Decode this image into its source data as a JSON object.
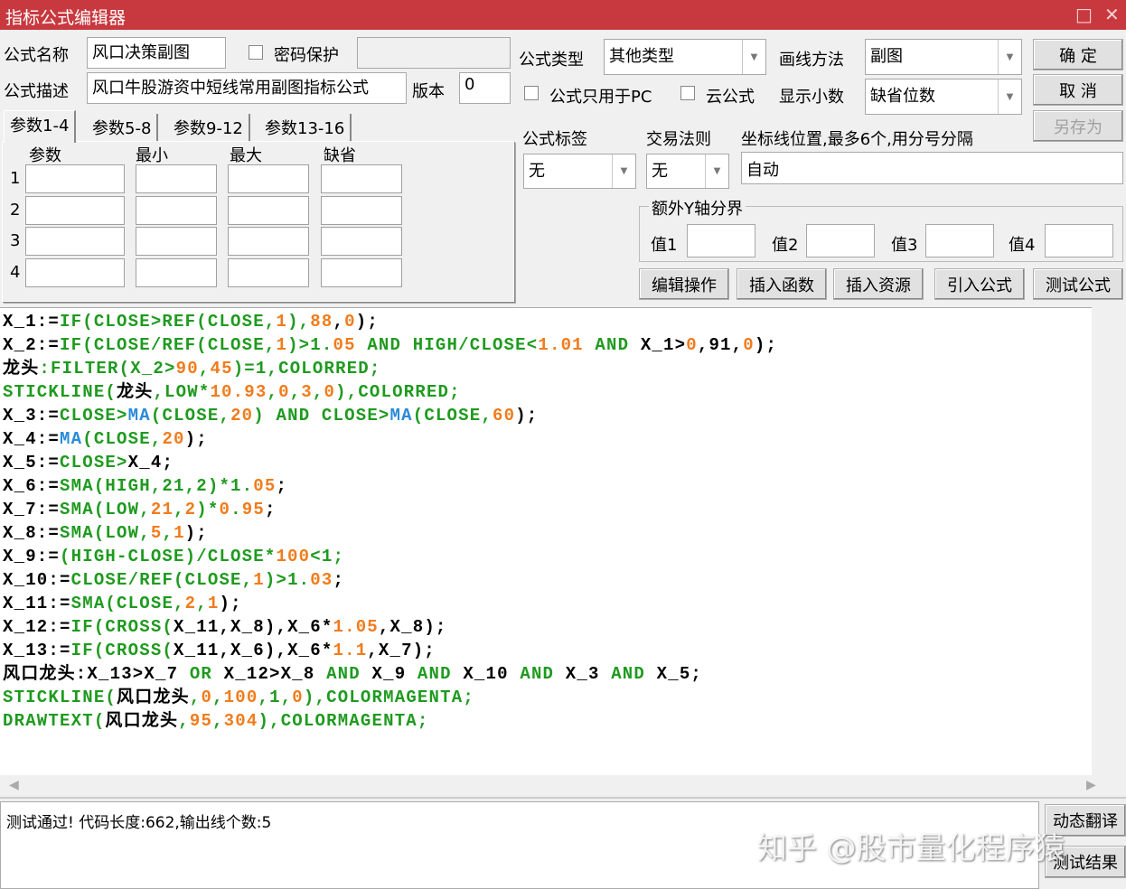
{
  "window": {
    "title": "指标公式编辑器",
    "maximize_icon": "□",
    "close_icon": "✕"
  },
  "form": {
    "name_label": "公式名称",
    "name_value": "风口决策副图",
    "password_label": "密码保护",
    "password_value": "",
    "desc_label": "公式描述",
    "desc_value": "风口牛股游资中短线常用副图指标公式",
    "version_label": "版本",
    "version_value": "0",
    "type_label": "公式类型",
    "type_value": "其他类型",
    "draw_label": "画线方法",
    "draw_value": "副图",
    "pc_only_label": "公式只用于PC",
    "cloud_label": "云公式",
    "decimal_label": "显示小数",
    "decimal_value": "缺省位数",
    "tag_label": "公式标签",
    "tag_value": "无",
    "rule_label": "交易法则",
    "rule_value": "无",
    "axis_label": "坐标线位置,最多6个,用分号分隔",
    "axis_value": "自动",
    "yaxis_group": "额外Y轴分界",
    "yvals": [
      "值1",
      "值2",
      "值3",
      "值4"
    ]
  },
  "buttons": {
    "ok": "确  定",
    "cancel": "取  消",
    "save_as": "另存为",
    "edit": "编辑操作",
    "insert_func": "插入函数",
    "insert_res": "插入资源",
    "import": "引入公式",
    "test": "测试公式",
    "dynamic": "动态翻译",
    "test_result": "测试结果"
  },
  "params": {
    "tabs": [
      "参数1-4",
      "参数5-8",
      "参数9-12",
      "参数13-16"
    ],
    "headers": [
      "参数",
      "最小",
      "最大",
      "缺省"
    ],
    "rows": [
      "1",
      "2",
      "3",
      "4"
    ]
  },
  "code_lines": [
    [
      [
        "X_1:=",
        "v"
      ],
      [
        "IF(CLOSE>REF(CLOSE,",
        "k"
      ],
      [
        "1",
        "n"
      ],
      [
        "),",
        "k"
      ],
      [
        "88",
        "n"
      ],
      [
        ",",
        "v"
      ],
      [
        "0",
        "n"
      ],
      [
        ");",
        "v"
      ]
    ],
    [
      [
        "X_2:=",
        "v"
      ],
      [
        "IF(CLOSE/REF(CLOSE,",
        "k"
      ],
      [
        "1",
        "n"
      ],
      [
        ")>",
        "k"
      ],
      [
        "1.",
        "k"
      ],
      [
        "05",
        "n"
      ],
      [
        " AND HIGH/CLOSE<",
        "k"
      ],
      [
        "1.",
        "n"
      ],
      [
        "01",
        "n"
      ],
      [
        " AND ",
        "k"
      ],
      [
        "X_1>",
        "v"
      ],
      [
        "0",
        "n"
      ],
      [
        ",91,",
        "v"
      ],
      [
        "0",
        "n"
      ],
      [
        ");",
        "v"
      ]
    ],
    [
      [
        "龙头",
        "v"
      ],
      [
        ":FILTER(X_2>",
        "k"
      ],
      [
        "90",
        "n"
      ],
      [
        ",",
        "k"
      ],
      [
        "45",
        "n"
      ],
      [
        ")=1,COLORRED;",
        "k"
      ]
    ],
    [
      [
        "STICKLINE(",
        "k"
      ],
      [
        "龙头",
        "v"
      ],
      [
        ",LOW*",
        "k"
      ],
      [
        "10.93",
        "n"
      ],
      [
        ",",
        "k"
      ],
      [
        "0",
        "n"
      ],
      [
        ",",
        "k"
      ],
      [
        "3",
        "n"
      ],
      [
        ",",
        "k"
      ],
      [
        "0",
        "n"
      ],
      [
        "),COLORRED;",
        "k"
      ]
    ],
    [
      [
        "X_3:=",
        "v"
      ],
      [
        "CLOSE>",
        "k"
      ],
      [
        "MA",
        "b"
      ],
      [
        "(CLOSE,",
        "k"
      ],
      [
        "20",
        "n"
      ],
      [
        ") AND CLOSE>",
        "k"
      ],
      [
        "MA",
        "b"
      ],
      [
        "(CLOSE,",
        "k"
      ],
      [
        "60",
        "n"
      ],
      [
        ");",
        "v"
      ]
    ],
    [
      [
        "X_4:=",
        "v"
      ],
      [
        "MA",
        "b"
      ],
      [
        "(CLOSE,",
        "k"
      ],
      [
        "20",
        "n"
      ],
      [
        ");",
        "v"
      ]
    ],
    [
      [
        "X_5:=",
        "v"
      ],
      [
        "CLOSE>",
        "k"
      ],
      [
        "X_4;",
        "v"
      ]
    ],
    [
      [
        "X_6:=",
        "v"
      ],
      [
        "SMA(HIGH,21,2)*",
        "k"
      ],
      [
        "1.",
        "k"
      ],
      [
        "05",
        "n"
      ],
      [
        ";",
        "v"
      ]
    ],
    [
      [
        "X_7:=",
        "v"
      ],
      [
        "SMA(LOW,",
        "k"
      ],
      [
        "21",
        "n"
      ],
      [
        ",",
        "k"
      ],
      [
        "2",
        "n"
      ],
      [
        ")*",
        "k"
      ],
      [
        "0",
        "n"
      ],
      [
        ".",
        "k"
      ],
      [
        "95",
        "n"
      ],
      [
        ";",
        "v"
      ]
    ],
    [
      [
        "X_8:=",
        "v"
      ],
      [
        "SMA(LOW,",
        "k"
      ],
      [
        "5",
        "n"
      ],
      [
        ",",
        "k"
      ],
      [
        "1",
        "n"
      ],
      [
        ");",
        "v"
      ]
    ],
    [
      [
        "X_9:=",
        "v"
      ],
      [
        "(HIGH-CLOSE)/CLOSE*",
        "k"
      ],
      [
        "100",
        "n"
      ],
      [
        "<1;",
        "k"
      ]
    ],
    [
      [
        "X_10:=",
        "v"
      ],
      [
        "CLOSE/REF(CLOSE,",
        "k"
      ],
      [
        "1",
        "n"
      ],
      [
        ")>1.",
        "k"
      ],
      [
        "03",
        "n"
      ],
      [
        ";",
        "v"
      ]
    ],
    [
      [
        "X_11:=",
        "v"
      ],
      [
        "SMA(CLOSE,",
        "k"
      ],
      [
        "2",
        "n"
      ],
      [
        ",",
        "k"
      ],
      [
        "1",
        "n"
      ],
      [
        ");",
        "v"
      ]
    ],
    [
      [
        "X_12:=",
        "v"
      ],
      [
        "IF(CROSS(",
        "k"
      ],
      [
        "X_11,X_8),X_6*",
        "v"
      ],
      [
        "1.",
        "n"
      ],
      [
        "05",
        "n"
      ],
      [
        ",X_8);",
        "v"
      ]
    ],
    [
      [
        "X_13:=",
        "v"
      ],
      [
        "IF(CROSS(",
        "k"
      ],
      [
        "X_11,X_6),X_6*",
        "v"
      ],
      [
        "1.1",
        "n"
      ],
      [
        ",X_7);",
        "v"
      ]
    ],
    [
      [
        "风口龙头:X_13>X_7 ",
        "v"
      ],
      [
        "OR ",
        "k"
      ],
      [
        "X_12>X_8 ",
        "v"
      ],
      [
        "AND ",
        "k"
      ],
      [
        "X_9 ",
        "v"
      ],
      [
        "AND ",
        "k"
      ],
      [
        "X_10 ",
        "v"
      ],
      [
        "AND ",
        "k"
      ],
      [
        "X_3 ",
        "v"
      ],
      [
        "AND ",
        "k"
      ],
      [
        "X_5;",
        "v"
      ]
    ],
    [
      [
        "STICKLINE(",
        "k"
      ],
      [
        "风口龙头",
        "v"
      ],
      [
        ",",
        "k"
      ],
      [
        "0",
        "n"
      ],
      [
        ",",
        "k"
      ],
      [
        "100",
        "n"
      ],
      [
        ",1,",
        "k"
      ],
      [
        "0",
        "n"
      ],
      [
        "),COLORMAGENTA;",
        "k"
      ]
    ],
    [
      [
        "DRAWTEXT(",
        "k"
      ],
      [
        "风口龙头",
        "v"
      ],
      [
        ",",
        "k"
      ],
      [
        "95",
        "n"
      ],
      [
        ",",
        "k"
      ],
      [
        "304",
        "n"
      ],
      [
        "),COLORMAGENTA;",
        "k"
      ]
    ]
  ],
  "output": {
    "message": "测试通过! 代码长度:662,输出线个数:5"
  },
  "watermark": "知乎 @股市量化程序猿",
  "colors": {
    "title_bar": "#c8393f",
    "keyword": "#1f9a1f",
    "number": "#f07c1c",
    "function_ma": "#2a8ad8"
  }
}
